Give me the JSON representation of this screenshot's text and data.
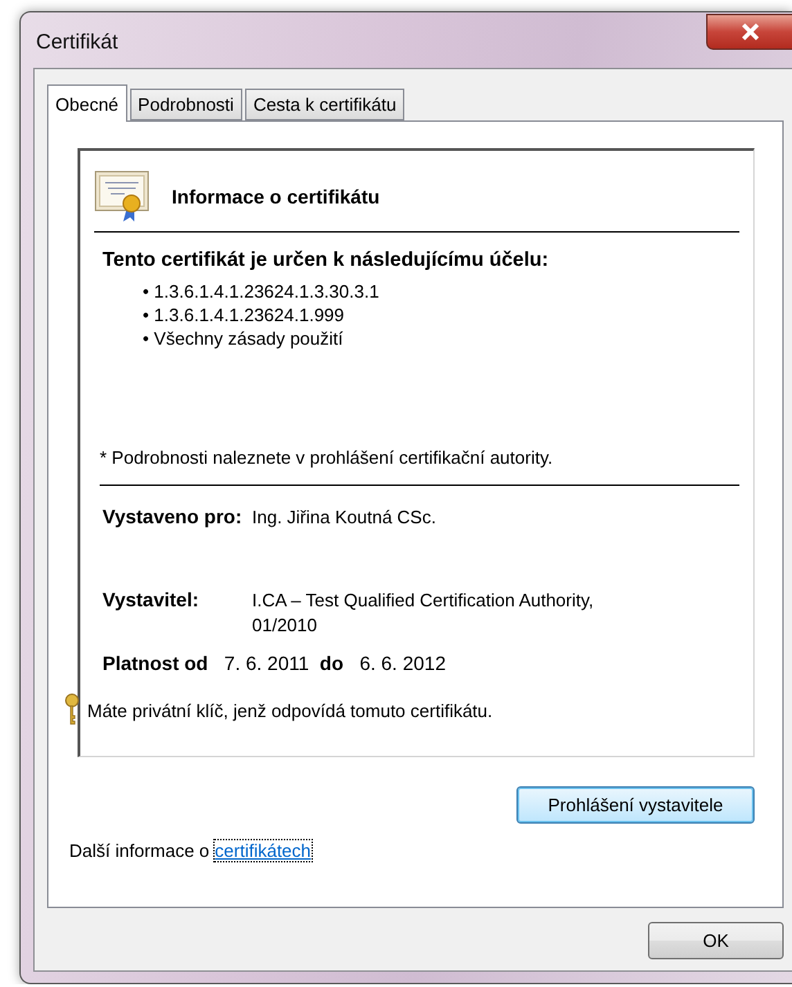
{
  "window": {
    "title": "Certifikát"
  },
  "tabs": [
    {
      "label": "Obecné",
      "selected": true
    },
    {
      "label": "Podrobnosti",
      "selected": false
    },
    {
      "label": "Cesta k certifikátu",
      "selected": false
    }
  ],
  "certificate": {
    "heading": "Informace o certifikátu",
    "purpose_heading": "Tento certifikát je určen k následujícímu účelu:",
    "purposes": [
      "• 1.3.6.1.4.1.23624.1.3.30.3.1",
      "• 1.3.6.1.4.1.23624.1.999",
      "• Všechny zásady použití"
    ],
    "footnote": "* Podrobnosti naleznete v prohlášení certifikační autority.",
    "fields": [
      {
        "label": "Vystaveno pro:",
        "value": "Ing. Jiřina Koutná CSc."
      },
      {
        "label": "Vystavitel:",
        "value": "I.CA – Test Qualified Certification Authority, 01/2010"
      }
    ],
    "validity": "**Platnost od**   7. 6. 2011  **do**   6. 6. 2012",
    "private_key_note": "Máte privátní klíč, jenž odpovídá tomuto certifikátu."
  },
  "issuer_statement_button": "Prohlášení vystavitele",
  "more_info": {
    "text": "Další informace o",
    "link": "certifikátech"
  },
  "buttons": [
    "OK"
  ]
}
